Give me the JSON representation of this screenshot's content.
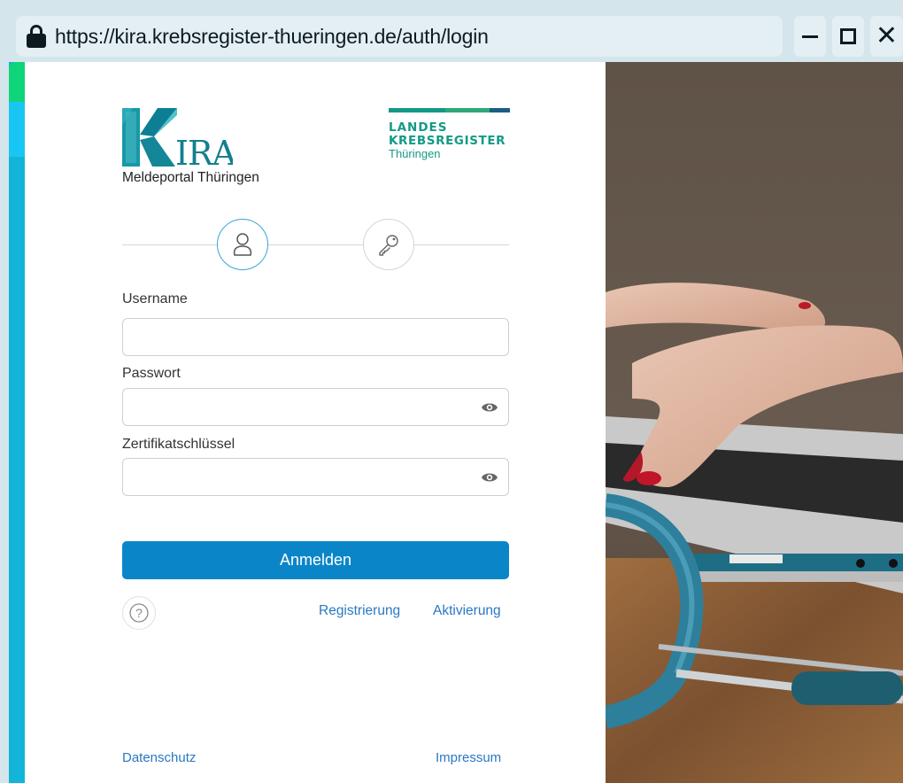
{
  "browser": {
    "url": "https://kira.krebsregister-thueringen.de/auth/login",
    "icons": {
      "lock": "lock-icon",
      "minimize": "minimize-icon",
      "maximize": "maximize-icon",
      "close": "close-icon"
    }
  },
  "branding": {
    "kira_logo_text": "KIRA",
    "portal_name": "Meldeportal Thüringen",
    "landes_line1": "LANDES",
    "landes_line2": "KREBSREGISTER",
    "landes_line3": "Thüringen"
  },
  "steps": [
    {
      "name": "user",
      "icon": "user-icon",
      "active": true
    },
    {
      "name": "key",
      "icon": "key-icon",
      "active": false
    }
  ],
  "form": {
    "username_label": "Username",
    "username_value": "",
    "password_label": "Passwort",
    "password_value": "",
    "cert_label": "Zertifikatschlüssel",
    "cert_value": "",
    "submit_label": "Anmelden"
  },
  "links": {
    "help_icon": "help-circle-icon",
    "register": "Registrierung",
    "activate": "Aktivierung",
    "privacy": "Datenschutz",
    "imprint": "Impressum"
  },
  "colors": {
    "accent": "#0a86c8",
    "link": "#2a78c2",
    "brand_green": "#139a86",
    "strip_cyan": "#12b5d8",
    "strip_green": "#10d47a"
  }
}
